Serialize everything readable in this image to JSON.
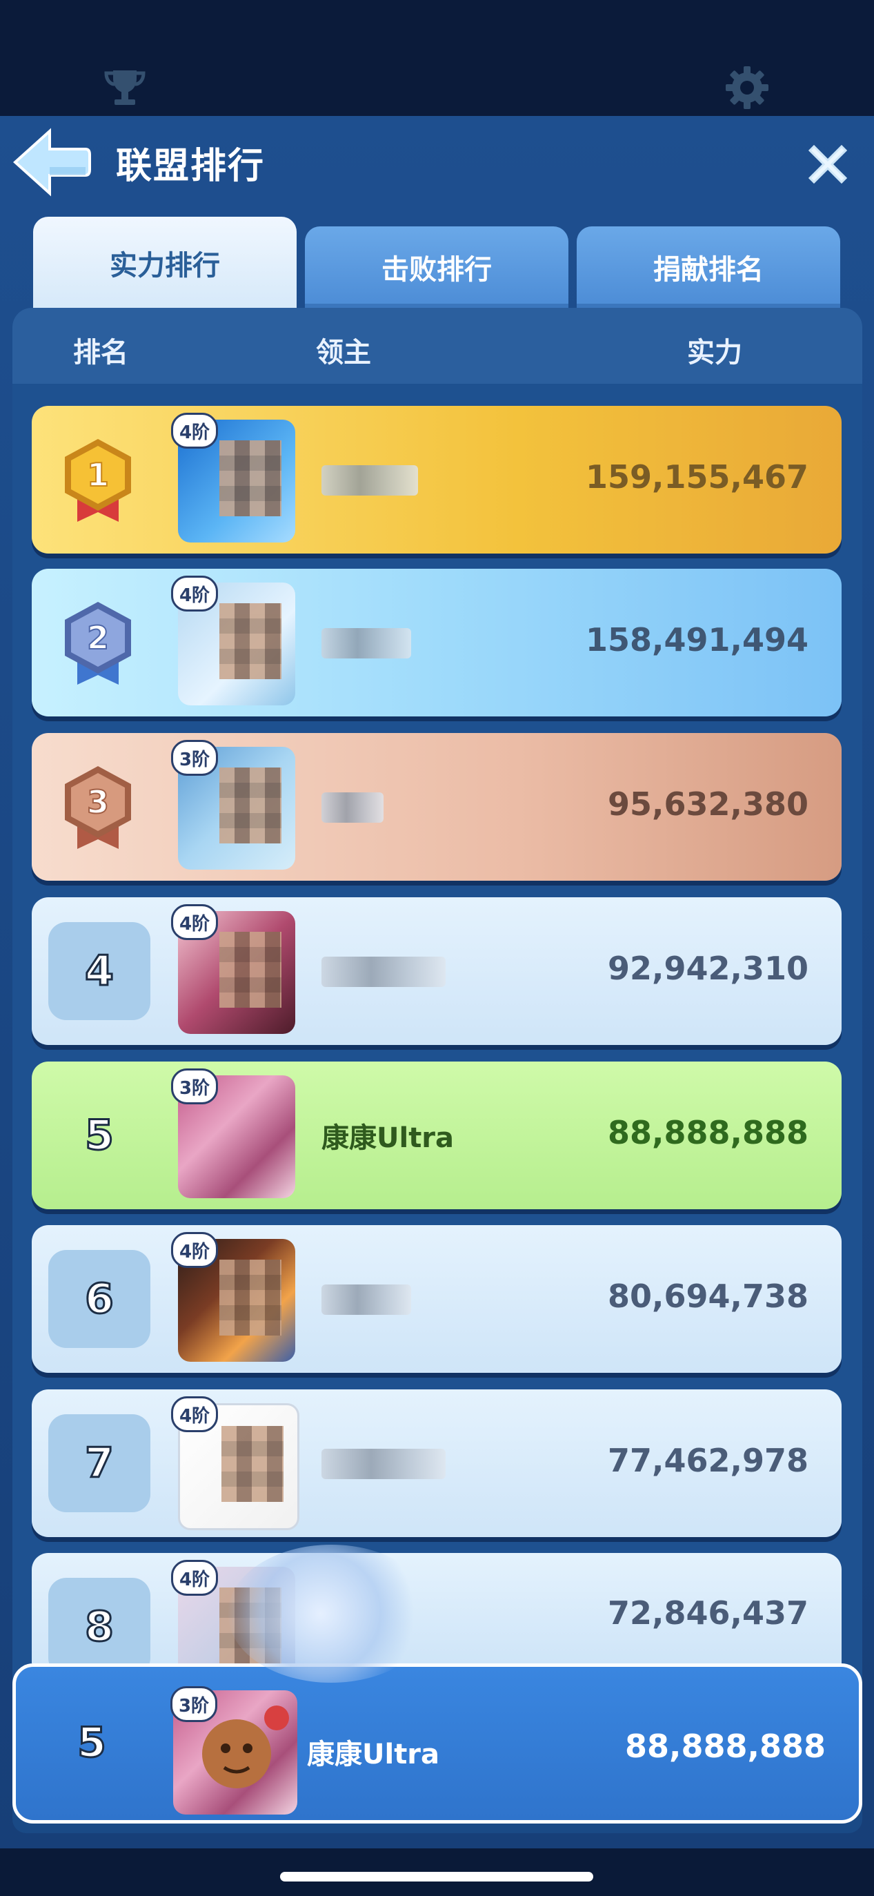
{
  "header": {
    "title": "联盟排行",
    "trophy_icon": "trophy-icon",
    "settings_icon": "gear-icon",
    "back_icon": "back-arrow-icon",
    "close_icon": "close-icon"
  },
  "tabs": [
    {
      "label": "实力排行",
      "active": true
    },
    {
      "label": "击败排行",
      "active": false
    },
    {
      "label": "捐献排名",
      "active": false
    }
  ],
  "columns": {
    "rank": "排名",
    "lord": "领主",
    "power": "实力"
  },
  "rows": [
    {
      "rank": "1",
      "tier": "4阶",
      "name": "",
      "power": "159,155,467",
      "style": "gold"
    },
    {
      "rank": "2",
      "tier": "4阶",
      "name": "",
      "power": "158,491,494",
      "style": "silver"
    },
    {
      "rank": "3",
      "tier": "3阶",
      "name": "",
      "power": "95,632,380",
      "style": "bronze"
    },
    {
      "rank": "4",
      "tier": "4阶",
      "name": "",
      "power": "92,942,310",
      "style": "normal"
    },
    {
      "rank": "5",
      "tier": "3阶",
      "name": "康康Ultra",
      "power": "88,888,888",
      "style": "self"
    },
    {
      "rank": "6",
      "tier": "4阶",
      "name": "",
      "power": "80,694,738",
      "style": "normal"
    },
    {
      "rank": "7",
      "tier": "4阶",
      "name": "",
      "power": "77,462,978",
      "style": "normal"
    },
    {
      "rank": "8",
      "tier": "4阶",
      "name": "",
      "power": "72,846,437",
      "style": "normal"
    }
  ],
  "my_rank": {
    "rank": "5",
    "tier": "3阶",
    "name": "康康Ultra",
    "power": "88,888,888"
  },
  "colors": {
    "gold": "#f5c842",
    "silver": "#8fd3fb",
    "bronze": "#e8b7a0",
    "normal": "#d6ebfb",
    "self": "#bdf29a",
    "mine": "#3a86e0"
  }
}
